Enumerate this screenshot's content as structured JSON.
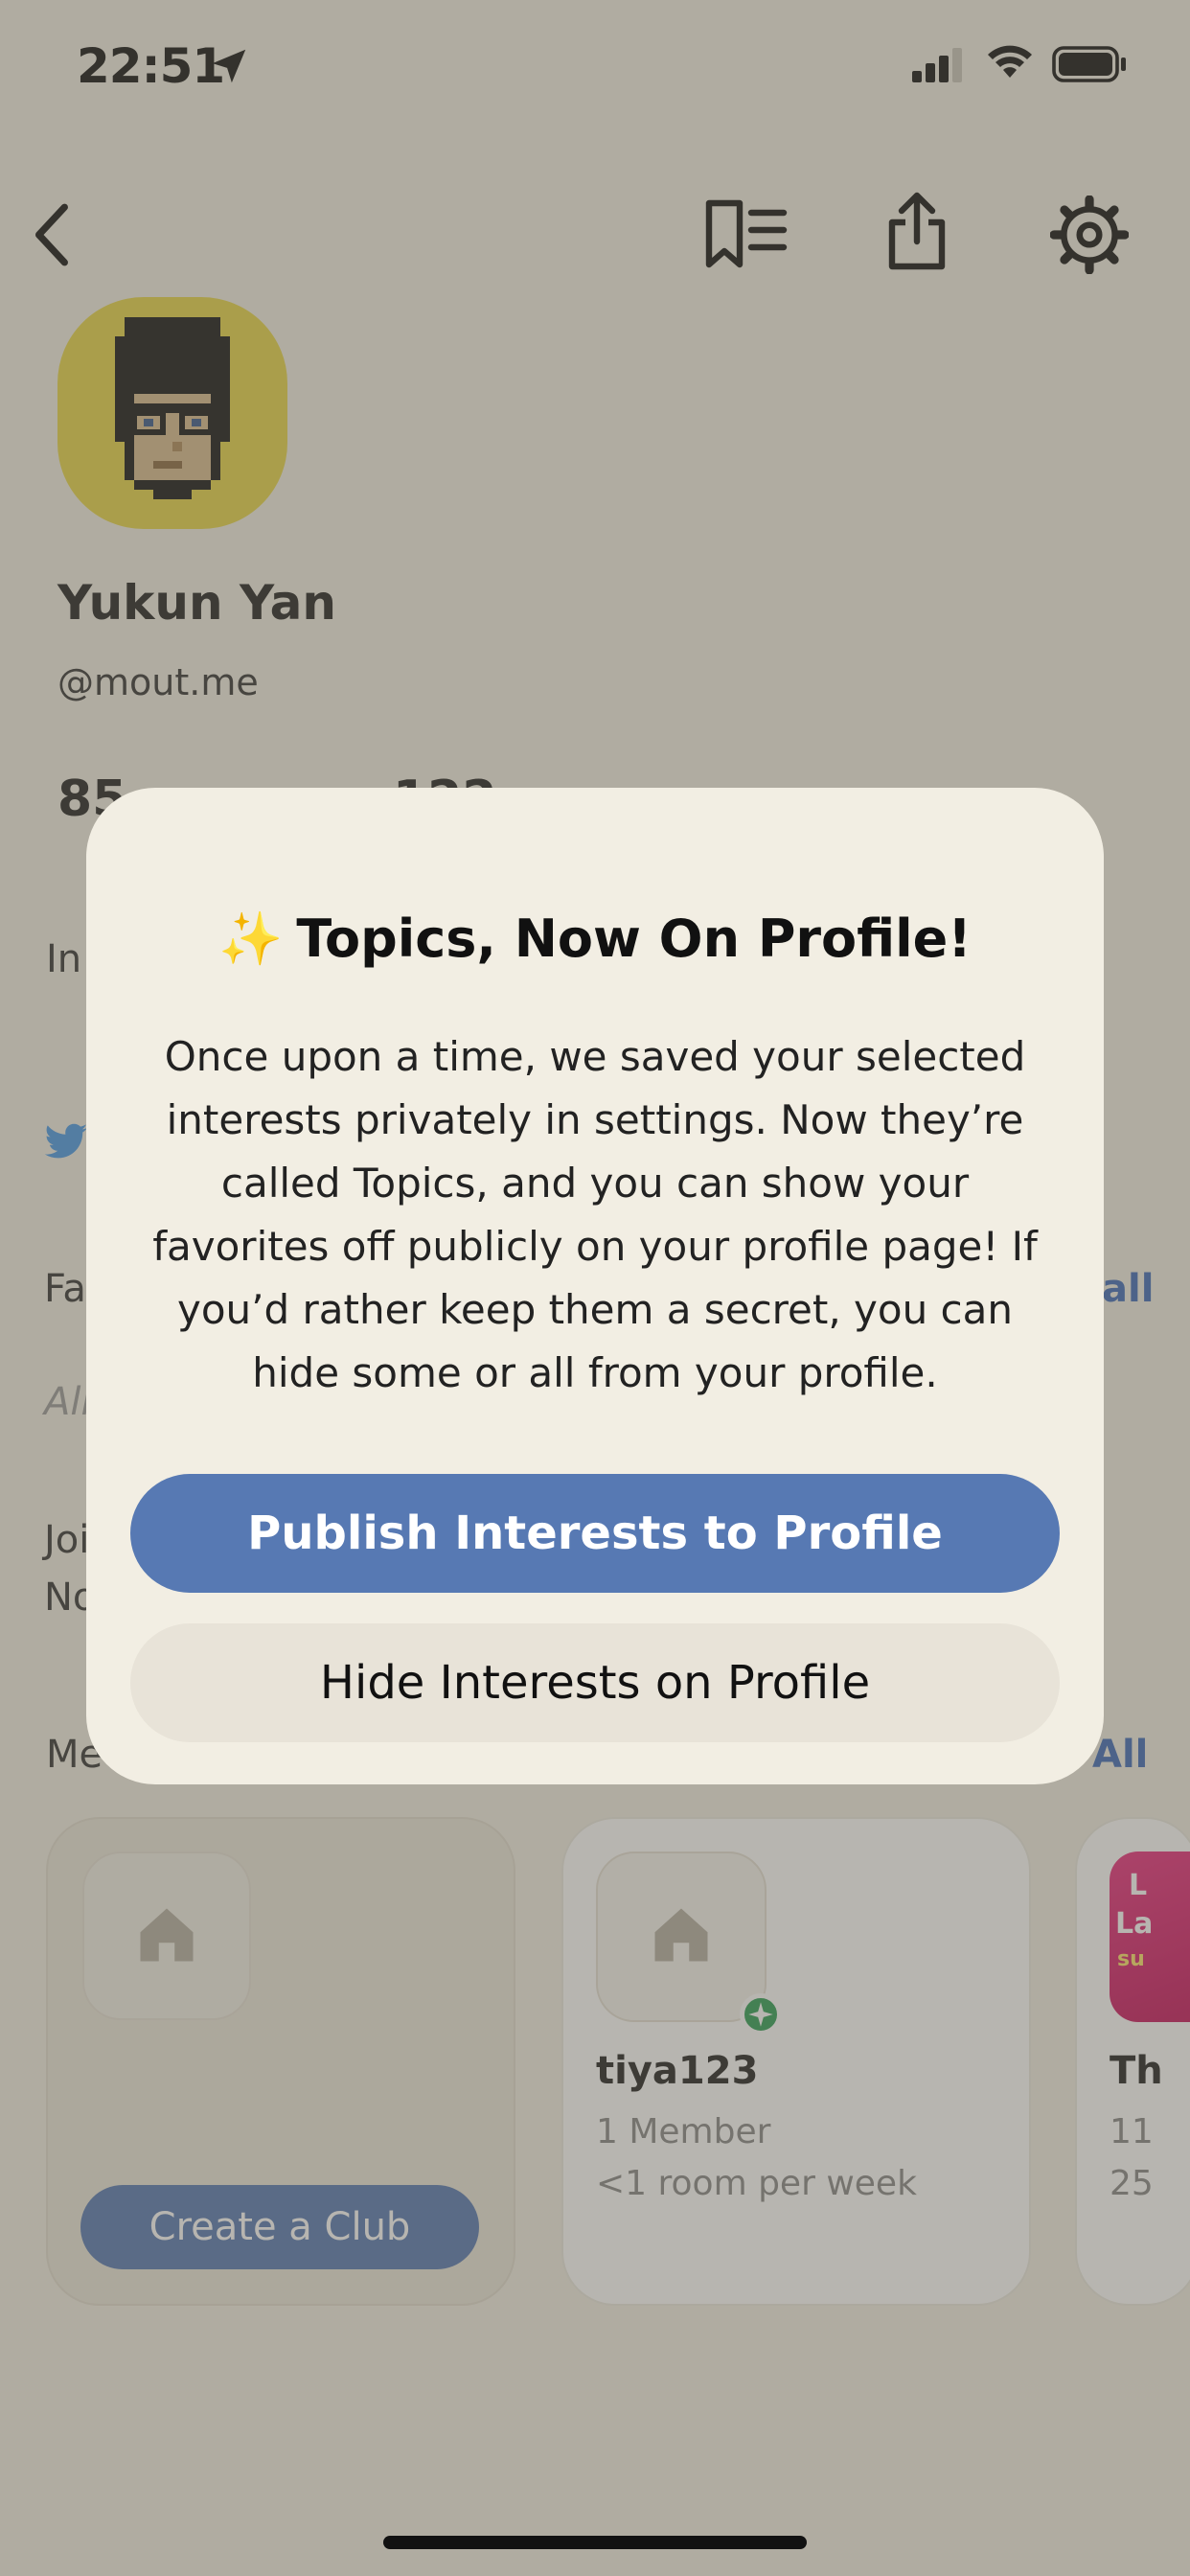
{
  "status_bar": {
    "time": "22:51",
    "icons": [
      "location-arrow-icon",
      "signal-icon",
      "wifi-icon",
      "battery-icon"
    ]
  },
  "nav": {
    "icons": [
      "back-chevron-icon",
      "bookmark-list-icon",
      "share-icon",
      "gear-icon"
    ]
  },
  "profile": {
    "name": "Yukun Yan",
    "handle": "@mout.me",
    "followers_fragment": "85",
    "following_fragment": "122",
    "fragments": {
      "interests": "In",
      "favorites": "Fa",
      "all_text": "All",
      "joined": "Joi",
      "nominated": "No",
      "members": "Me",
      "see_all_1": "all",
      "see_all_2": "All"
    }
  },
  "clubs": {
    "create_label": "Create a Club",
    "items": [
      {
        "name": "tiya123",
        "members": "1 Member",
        "rooms": "<1 room per week"
      },
      {
        "name": "Th",
        "members": "11",
        "rooms": "25"
      }
    ],
    "third_image_text": [
      "L",
      "La",
      "su"
    ]
  },
  "modal": {
    "sparkles": "✨",
    "title": "Topics, Now On Profile!",
    "body": "Once upon a time, we saved your selected interests privately in settings. Now they’re called Topics, and you can show your favorites off publicly on your profile page! If you’d rather keep them a secret, you can hide some or all from your profile.",
    "primary_label": "Publish Interests to Profile",
    "secondary_label": "Hide Interests on Profile"
  },
  "colors": {
    "accent": "#5779b3",
    "background": "#f2efe4",
    "modal_bg": "#f2eee3",
    "online": "#2f9e56",
    "avatar_bg": "#e8d648"
  }
}
